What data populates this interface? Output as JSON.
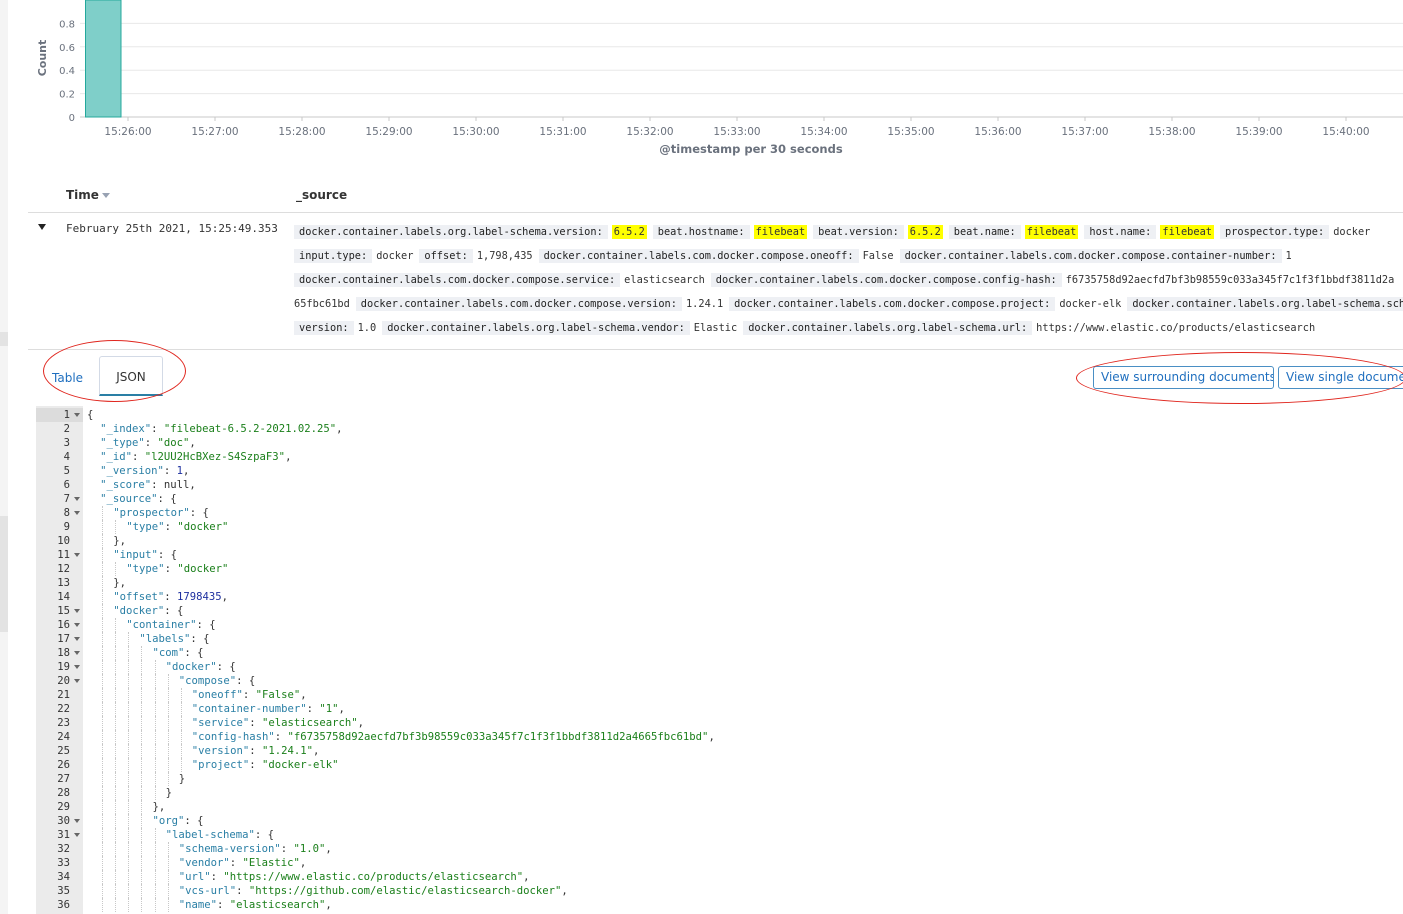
{
  "histogram": {
    "y_axis_label": "Count",
    "x_axis_label": "@timestamp per 30 seconds",
    "colors": {
      "bar": "#7fcfc9",
      "bar_edge": "#24a89c",
      "axis_text": "#6a717d",
      "grid": "#e8e8e8"
    }
  },
  "chart_data": {
    "type": "bar",
    "xlabel": "@timestamp per 30 seconds",
    "ylabel": "Count",
    "y_ticks": [
      "0",
      "0.2",
      "0.4",
      "0.6",
      "0.8"
    ],
    "x_ticks": [
      "15:26:00",
      "15:27:00",
      "15:28:00",
      "15:29:00",
      "15:30:00",
      "15:31:00",
      "15:32:00",
      "15:33:00",
      "15:34:00",
      "15:35:00",
      "15:36:00",
      "15:37:00",
      "15:38:00",
      "15:39:00",
      "15:40:00"
    ],
    "bars": [
      {
        "start": "15:25:30",
        "end": "15:26:00",
        "value": 1
      }
    ],
    "ylim": [
      0,
      1
    ]
  },
  "table": {
    "header_time": "Time",
    "header_source": "_source",
    "row_time": "February 25th 2021, 15:25:49.353",
    "source_lines": [
      [
        {
          "k": "docker.container.labels.org.label-schema.version:",
          "v": "6.5.2",
          "hl": true
        },
        {
          "k": "beat.hostname:",
          "v": "filebeat",
          "hl": true
        },
        {
          "k": "beat.version:",
          "v": "6.5.2",
          "hl": true
        },
        {
          "k": "beat.name:",
          "v": "filebeat",
          "hl": true
        },
        {
          "k": "host.name:",
          "v": "filebeat",
          "hl": true
        },
        {
          "k": "prospector.type:",
          "v": "docker",
          "hl": false
        }
      ],
      [
        {
          "k": "input.type:",
          "v": "docker",
          "hl": false
        },
        {
          "k": "offset:",
          "v": "1,798,435",
          "hl": false
        },
        {
          "k": "docker.container.labels.com.docker.compose.oneoff:",
          "v": "False",
          "hl": false
        },
        {
          "k": "docker.container.labels.com.docker.compose.container-number:",
          "v": "1",
          "hl": false
        }
      ],
      [
        {
          "k": "docker.container.labels.com.docker.compose.service:",
          "v": "elasticsearch",
          "hl": false
        },
        {
          "k": "docker.container.labels.com.docker.compose.config-hash:",
          "v": "f6735758d92aecfd7bf3b98559c033a345f7c1f3f1bbdf3811d2a",
          "hl": false
        }
      ],
      [
        {
          "k": "",
          "v": "65fbc61bd",
          "hl": false
        },
        {
          "k": "docker.container.labels.com.docker.compose.version:",
          "v": "1.24.1",
          "hl": false
        },
        {
          "k": "docker.container.labels.com.docker.compose.project:",
          "v": "docker-elk",
          "hl": false
        },
        {
          "k": "docker.container.labels.org.label-schema.schem",
          "v": "",
          "hl": false
        }
      ],
      [
        {
          "k": "version:",
          "v": "1.0",
          "hl": false
        },
        {
          "k": "docker.container.labels.org.label-schema.vendor:",
          "v": "Elastic",
          "hl": false
        },
        {
          "k": "docker.container.labels.org.label-schema.url:",
          "v": "https://www.elastic.co/products/elasticsearch",
          "hl": false
        }
      ]
    ]
  },
  "tabs": {
    "table": "Table",
    "json": "JSON"
  },
  "buttons": {
    "surrounding": "View surrounding documents",
    "single": "View single document"
  },
  "annotation_color": "#e0261e",
  "editor": {
    "lines": [
      {
        "n": "1",
        "fold": true,
        "indent": 0,
        "parts": [
          [
            "p",
            "{"
          ]
        ]
      },
      {
        "n": "2",
        "fold": false,
        "indent": 1,
        "parts": [
          [
            "k",
            "\"_index\""
          ],
          [
            "p",
            ": "
          ],
          [
            "s",
            "\"filebeat-6.5.2-2021.02.25\""
          ],
          [
            "p",
            ","
          ]
        ]
      },
      {
        "n": "3",
        "fold": false,
        "indent": 1,
        "parts": [
          [
            "k",
            "\"_type\""
          ],
          [
            "p",
            ": "
          ],
          [
            "s",
            "\"doc\""
          ],
          [
            "p",
            ","
          ]
        ]
      },
      {
        "n": "4",
        "fold": false,
        "indent": 1,
        "parts": [
          [
            "k",
            "\"_id\""
          ],
          [
            "p",
            ": "
          ],
          [
            "s",
            "\"l2UU2HcBXez-S4SzpaF3\""
          ],
          [
            "p",
            ","
          ]
        ]
      },
      {
        "n": "5",
        "fold": false,
        "indent": 1,
        "parts": [
          [
            "k",
            "\"_version\""
          ],
          [
            "p",
            ": "
          ],
          [
            "n",
            "1"
          ],
          [
            "p",
            ","
          ]
        ]
      },
      {
        "n": "6",
        "fold": false,
        "indent": 1,
        "parts": [
          [
            "k",
            "\"_score\""
          ],
          [
            "p",
            ": "
          ],
          [
            "w",
            "null"
          ],
          [
            "p",
            ","
          ]
        ]
      },
      {
        "n": "7",
        "fold": true,
        "indent": 1,
        "parts": [
          [
            "k",
            "\"_source\""
          ],
          [
            "p",
            ": {"
          ]
        ]
      },
      {
        "n": "8",
        "fold": true,
        "indent": 2,
        "parts": [
          [
            "k",
            "\"prospector\""
          ],
          [
            "p",
            ": {"
          ]
        ]
      },
      {
        "n": "9",
        "fold": false,
        "indent": 3,
        "parts": [
          [
            "k",
            "\"type\""
          ],
          [
            "p",
            ": "
          ],
          [
            "s",
            "\"docker\""
          ]
        ]
      },
      {
        "n": "10",
        "fold": false,
        "indent": 2,
        "parts": [
          [
            "p",
            "},"
          ]
        ]
      },
      {
        "n": "11",
        "fold": true,
        "indent": 2,
        "parts": [
          [
            "k",
            "\"input\""
          ],
          [
            "p",
            ": {"
          ]
        ]
      },
      {
        "n": "12",
        "fold": false,
        "indent": 3,
        "parts": [
          [
            "k",
            "\"type\""
          ],
          [
            "p",
            ": "
          ],
          [
            "s",
            "\"docker\""
          ]
        ]
      },
      {
        "n": "13",
        "fold": false,
        "indent": 2,
        "parts": [
          [
            "p",
            "},"
          ]
        ]
      },
      {
        "n": "14",
        "fold": false,
        "indent": 2,
        "parts": [
          [
            "k",
            "\"offset\""
          ],
          [
            "p",
            ": "
          ],
          [
            "n",
            "1798435"
          ],
          [
            "p",
            ","
          ]
        ]
      },
      {
        "n": "15",
        "fold": true,
        "indent": 2,
        "parts": [
          [
            "k",
            "\"docker\""
          ],
          [
            "p",
            ": {"
          ]
        ]
      },
      {
        "n": "16",
        "fold": true,
        "indent": 3,
        "parts": [
          [
            "k",
            "\"container\""
          ],
          [
            "p",
            ": {"
          ]
        ]
      },
      {
        "n": "17",
        "fold": true,
        "indent": 4,
        "parts": [
          [
            "k",
            "\"labels\""
          ],
          [
            "p",
            ": {"
          ]
        ]
      },
      {
        "n": "18",
        "fold": true,
        "indent": 5,
        "parts": [
          [
            "k",
            "\"com\""
          ],
          [
            "p",
            ": {"
          ]
        ]
      },
      {
        "n": "19",
        "fold": true,
        "indent": 6,
        "parts": [
          [
            "k",
            "\"docker\""
          ],
          [
            "p",
            ": {"
          ]
        ]
      },
      {
        "n": "20",
        "fold": true,
        "indent": 7,
        "parts": [
          [
            "k",
            "\"compose\""
          ],
          [
            "p",
            ": {"
          ]
        ]
      },
      {
        "n": "21",
        "fold": false,
        "indent": 8,
        "parts": [
          [
            "k",
            "\"oneoff\""
          ],
          [
            "p",
            ": "
          ],
          [
            "s",
            "\"False\""
          ],
          [
            "p",
            ","
          ]
        ]
      },
      {
        "n": "22",
        "fold": false,
        "indent": 8,
        "parts": [
          [
            "k",
            "\"container-number\""
          ],
          [
            "p",
            ": "
          ],
          [
            "s",
            "\"1\""
          ],
          [
            "p",
            ","
          ]
        ]
      },
      {
        "n": "23",
        "fold": false,
        "indent": 8,
        "parts": [
          [
            "k",
            "\"service\""
          ],
          [
            "p",
            ": "
          ],
          [
            "s",
            "\"elasticsearch\""
          ],
          [
            "p",
            ","
          ]
        ]
      },
      {
        "n": "24",
        "fold": false,
        "indent": 8,
        "parts": [
          [
            "k",
            "\"config-hash\""
          ],
          [
            "p",
            ": "
          ],
          [
            "s",
            "\"f6735758d92aecfd7bf3b98559c033a345f7c1f3f1bbdf3811d2a4665fbc61bd\""
          ],
          [
            "p",
            ","
          ]
        ]
      },
      {
        "n": "25",
        "fold": false,
        "indent": 8,
        "parts": [
          [
            "k",
            "\"version\""
          ],
          [
            "p",
            ": "
          ],
          [
            "s",
            "\"1.24.1\""
          ],
          [
            "p",
            ","
          ]
        ]
      },
      {
        "n": "26",
        "fold": false,
        "indent": 8,
        "parts": [
          [
            "k",
            "\"project\""
          ],
          [
            "p",
            ": "
          ],
          [
            "s",
            "\"docker-elk\""
          ]
        ]
      },
      {
        "n": "27",
        "fold": false,
        "indent": 7,
        "parts": [
          [
            "p",
            "}"
          ]
        ]
      },
      {
        "n": "28",
        "fold": false,
        "indent": 6,
        "parts": [
          [
            "p",
            "}"
          ]
        ]
      },
      {
        "n": "29",
        "fold": false,
        "indent": 5,
        "parts": [
          [
            "p",
            "},"
          ]
        ]
      },
      {
        "n": "30",
        "fold": true,
        "indent": 5,
        "parts": [
          [
            "k",
            "\"org\""
          ],
          [
            "p",
            ": {"
          ]
        ]
      },
      {
        "n": "31",
        "fold": true,
        "indent": 6,
        "parts": [
          [
            "k",
            "\"label-schema\""
          ],
          [
            "p",
            ": {"
          ]
        ]
      },
      {
        "n": "32",
        "fold": false,
        "indent": 7,
        "parts": [
          [
            "k",
            "\"schema-version\""
          ],
          [
            "p",
            ": "
          ],
          [
            "s",
            "\"1.0\""
          ],
          [
            "p",
            ","
          ]
        ]
      },
      {
        "n": "33",
        "fold": false,
        "indent": 7,
        "parts": [
          [
            "k",
            "\"vendor\""
          ],
          [
            "p",
            ": "
          ],
          [
            "s",
            "\"Elastic\""
          ],
          [
            "p",
            ","
          ]
        ]
      },
      {
        "n": "34",
        "fold": false,
        "indent": 7,
        "parts": [
          [
            "k",
            "\"url\""
          ],
          [
            "p",
            ": "
          ],
          [
            "s",
            "\"https://www.elastic.co/products/elasticsearch\""
          ],
          [
            "p",
            ","
          ]
        ]
      },
      {
        "n": "35",
        "fold": false,
        "indent": 7,
        "parts": [
          [
            "k",
            "\"vcs-url\""
          ],
          [
            "p",
            ": "
          ],
          [
            "s",
            "\"https://github.com/elastic/elasticsearch-docker\""
          ],
          [
            "p",
            ","
          ]
        ]
      },
      {
        "n": "36",
        "fold": false,
        "indent": 7,
        "parts": [
          [
            "k",
            "\"name\""
          ],
          [
            "p",
            ": "
          ],
          [
            "s",
            "\"elasticsearch\""
          ],
          [
            "p",
            ","
          ]
        ]
      }
    ]
  }
}
